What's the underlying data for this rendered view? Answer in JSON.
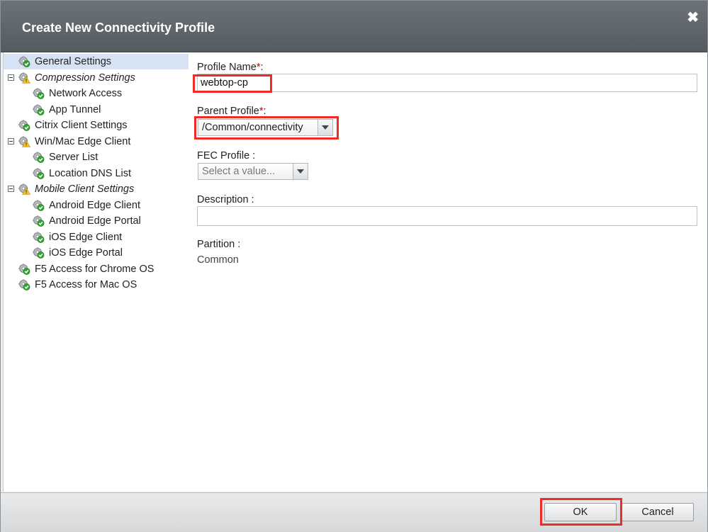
{
  "dialog": {
    "title": "Create New Connectivity Profile",
    "close_glyph": "✖"
  },
  "sidebar": {
    "items": [
      {
        "label": "General Settings",
        "icon": "gear-check-icon",
        "selected": true,
        "italic": false,
        "level": 0,
        "expandable": false
      },
      {
        "label": "Compression Settings",
        "icon": "gear-warning-icon",
        "selected": false,
        "italic": true,
        "level": 0,
        "expandable": true
      },
      {
        "label": "Network Access",
        "icon": "gear-check-icon",
        "selected": false,
        "italic": false,
        "level": 1,
        "expandable": false
      },
      {
        "label": "App Tunnel",
        "icon": "gear-check-icon",
        "selected": false,
        "italic": false,
        "level": 1,
        "expandable": false
      },
      {
        "label": "Citrix Client Settings",
        "icon": "gear-check-icon",
        "selected": false,
        "italic": false,
        "level": 0,
        "expandable": false
      },
      {
        "label": "Win/Mac Edge Client",
        "icon": "gear-warning-icon",
        "selected": false,
        "italic": false,
        "level": 0,
        "expandable": true
      },
      {
        "label": "Server List",
        "icon": "gear-check-icon",
        "selected": false,
        "italic": false,
        "level": 1,
        "expandable": false
      },
      {
        "label": "Location DNS List",
        "icon": "gear-check-icon",
        "selected": false,
        "italic": false,
        "level": 1,
        "expandable": false
      },
      {
        "label": "Mobile Client Settings",
        "icon": "gear-warning-icon",
        "selected": false,
        "italic": true,
        "level": 0,
        "expandable": true
      },
      {
        "label": "Android Edge Client",
        "icon": "gear-check-icon",
        "selected": false,
        "italic": false,
        "level": 1,
        "expandable": false
      },
      {
        "label": "Android Edge Portal",
        "icon": "gear-check-icon",
        "selected": false,
        "italic": false,
        "level": 1,
        "expandable": false
      },
      {
        "label": "iOS Edge Client",
        "icon": "gear-check-icon",
        "selected": false,
        "italic": false,
        "level": 1,
        "expandable": false
      },
      {
        "label": "iOS Edge Portal",
        "icon": "gear-check-icon",
        "selected": false,
        "italic": false,
        "level": 1,
        "expandable": false
      },
      {
        "label": "F5 Access for Chrome OS",
        "icon": "gear-check-icon",
        "selected": false,
        "italic": false,
        "level": 0,
        "expandable": false
      },
      {
        "label": "F5 Access for Mac OS",
        "icon": "gear-check-icon",
        "selected": false,
        "italic": false,
        "level": 0,
        "expandable": false
      }
    ]
  },
  "form": {
    "profile_name": {
      "label": "Profile Name",
      "required_mark": "*",
      "suffix": ":",
      "value": "webtop-cp"
    },
    "parent_profile": {
      "label": "Parent Profile",
      "required_mark": "*",
      "suffix": ":",
      "value": "/Common/connectivity"
    },
    "fec_profile": {
      "label": "FEC Profile",
      "suffix": ":",
      "placeholder": "Select a value..."
    },
    "description": {
      "label": "Description",
      "suffix": ":",
      "value": ""
    },
    "partition": {
      "label": "Partition",
      "suffix": ":",
      "value": "Common"
    }
  },
  "footer": {
    "ok_label": "OK",
    "cancel_label": "Cancel"
  },
  "colors": {
    "titlebar": "#5d646a",
    "highlight": "#ee2b24",
    "selected_row": "#d6e3f5",
    "required": "#cc0000",
    "check_green": "#2fa52f"
  }
}
